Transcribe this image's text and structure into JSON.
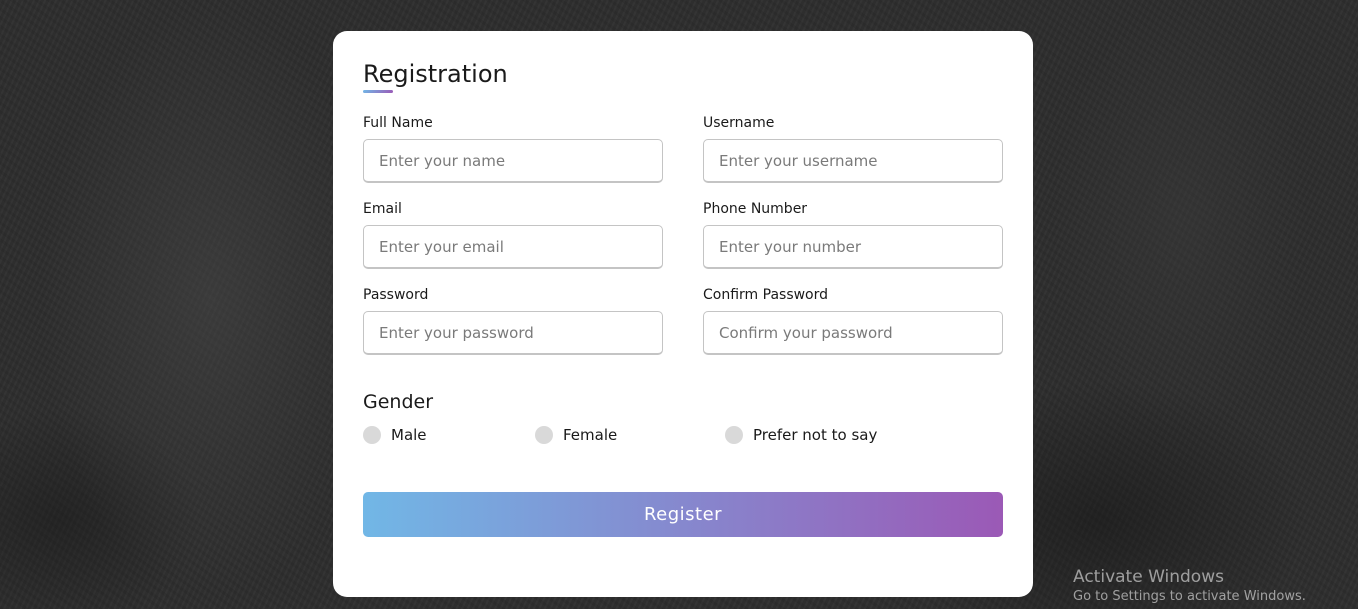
{
  "form": {
    "title": "Registration",
    "fields": [
      {
        "label": "Full Name",
        "placeholder": "Enter your name"
      },
      {
        "label": "Username",
        "placeholder": "Enter your username"
      },
      {
        "label": "Email",
        "placeholder": "Enter your email"
      },
      {
        "label": "Phone Number",
        "placeholder": "Enter your number"
      },
      {
        "label": "Password",
        "placeholder": "Enter your password"
      },
      {
        "label": "Confirm Password",
        "placeholder": "Confirm your password"
      }
    ],
    "gender": {
      "title": "Gender",
      "options": [
        "Male",
        "Female",
        "Prefer not to say"
      ],
      "selected": null
    },
    "register_label": "Register"
  },
  "colors": {
    "accent_gradient_start": "#71b7e6",
    "accent_gradient_end": "#9b59b6",
    "radio_unselected": "#d9d9d9"
  },
  "watermark": {
    "title": "Activate Windows",
    "subtitle": "Go to Settings to activate Windows."
  }
}
